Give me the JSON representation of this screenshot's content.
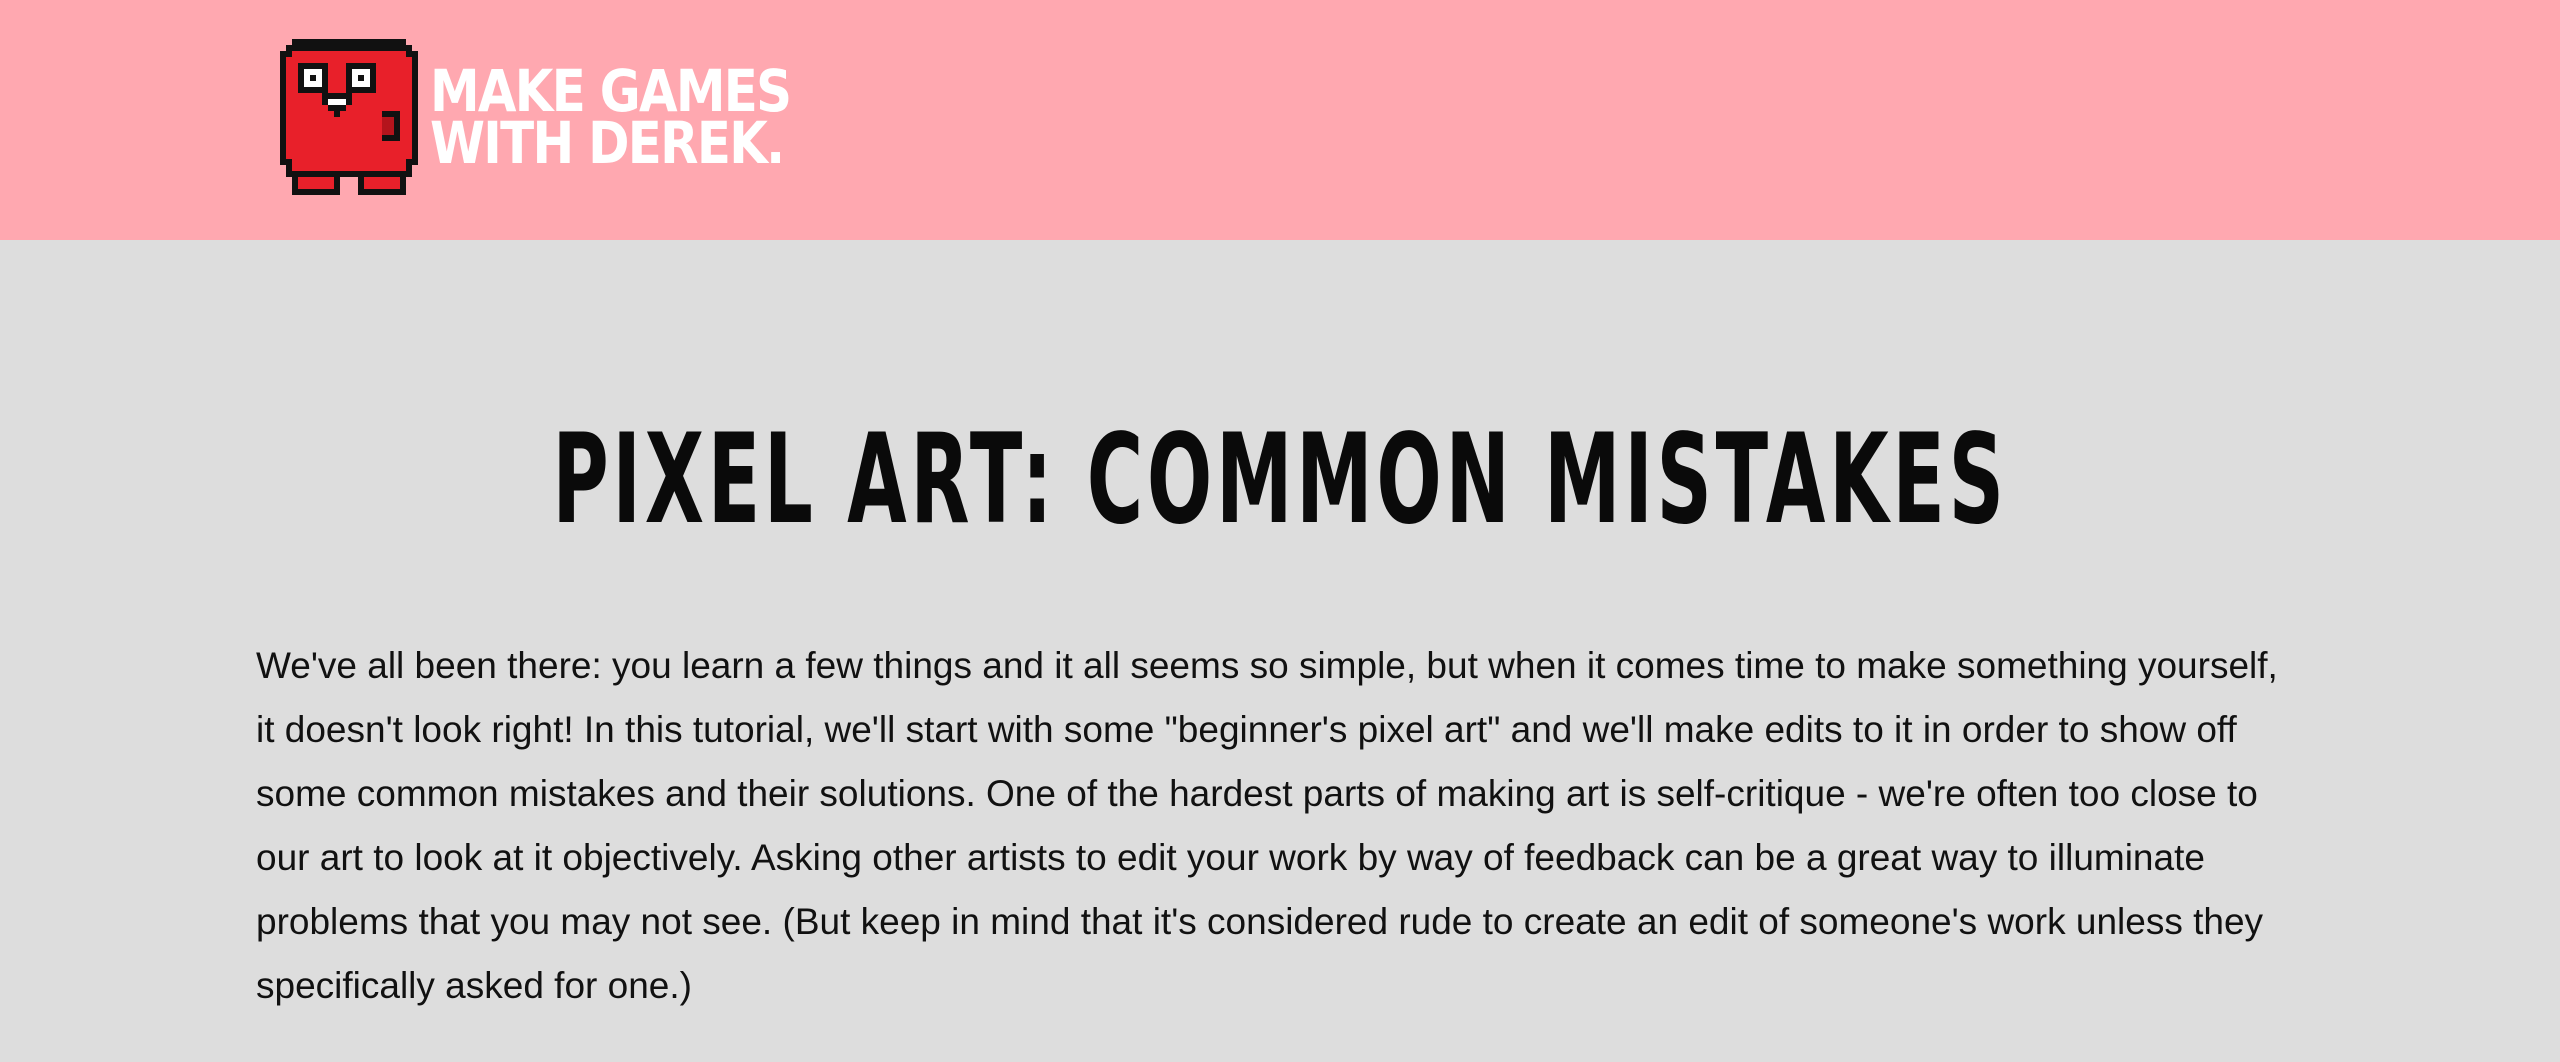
{
  "header": {
    "logo": {
      "line1": "MAKE GAMES",
      "line2": "WITH DEREK.",
      "icon": "red-pixel-mascot-icon"
    },
    "colors": {
      "background": "#ffa8b0",
      "logo_text": "#ffffff",
      "mascot": "#e8202a"
    }
  },
  "main": {
    "title": "PIXEL ART: COMMON MISTAKES",
    "intro": "We've all been there: you learn a few things and it all seems so simple, but when it comes time to make something yourself, it doesn't look right! In this tutorial, we'll start with some \"beginner's pixel art\" and we'll make edits to it in order to show off some common mistakes and their solutions. One of the hardest parts of making art is self-critique - we're often too close to our art to look at it objectively. Asking other artists to edit your work by way of feedback can be a great way to illuminate problems that you may not see. (But keep in mind that it's considered rude to create an edit of someone's work unless they specifically asked for one.)",
    "colors": {
      "background": "#dddddd",
      "text": "#111111"
    }
  }
}
